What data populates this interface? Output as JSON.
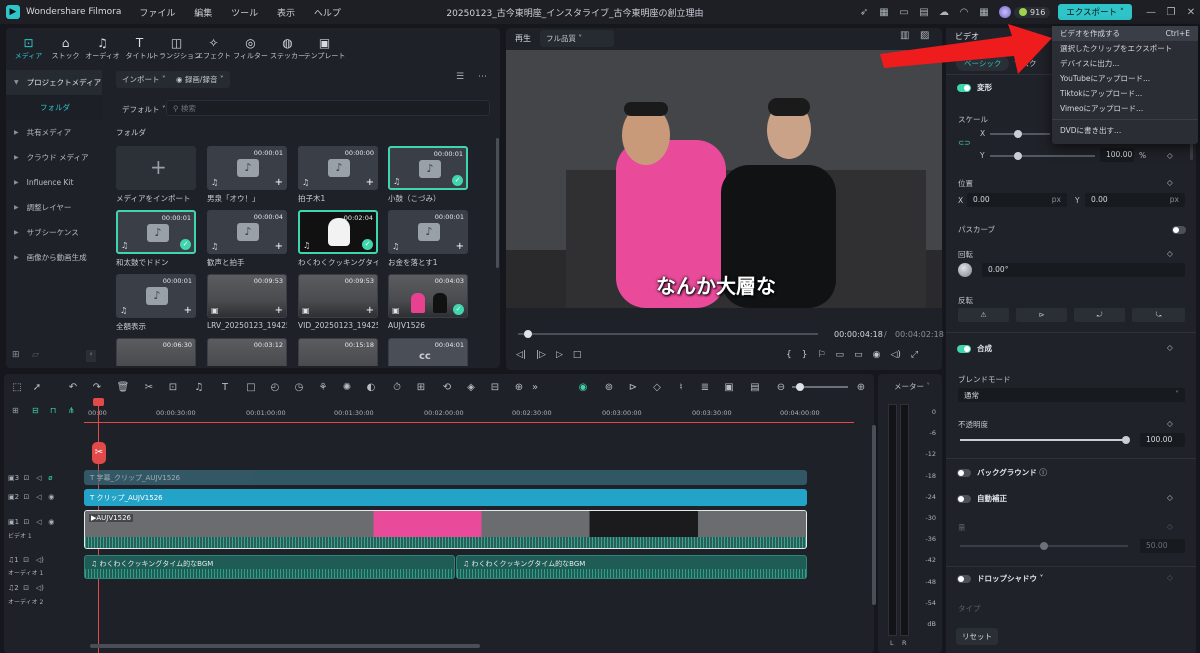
{
  "app": {
    "name": "Wondershare Filmora",
    "window_title": "20250123_古今東明座_インスタライブ_古今東明座の創立理由",
    "menu": [
      "ファイル",
      "編集",
      "ツール",
      "表示",
      "ヘルプ"
    ],
    "credits": "916",
    "export_label": "エクスポート"
  },
  "export_menu": [
    {
      "label": "ビデオを作成する",
      "shortcut": "Ctrl+E"
    },
    {
      "label": "選択したクリップをエクスポート",
      "shortcut": ""
    },
    {
      "label": "デバイスに出力...",
      "shortcut": ""
    },
    {
      "label": "YouTubeにアップロード...",
      "shortcut": ""
    },
    {
      "label": "Tiktokにアップロード...",
      "shortcut": ""
    },
    {
      "label": "Vimeoにアップロード...",
      "shortcut": ""
    },
    {
      "label": "DVDに書き出す...",
      "shortcut": ""
    }
  ],
  "media_tabs": [
    "メディア",
    "ストック",
    "オーディオ",
    "タイトル",
    "トランジション",
    "エフェクト",
    "フィルター",
    "ステッカー",
    "テンプレート"
  ],
  "tree": [
    "プロジェクトメディア",
    "フォルダ",
    "共有メディア",
    "クラウド メディア",
    "Influence Kit",
    "調整レイヤー",
    "サブシーケンス",
    "画像から動画生成"
  ],
  "media_toolbar": {
    "import": "インポート",
    "record": "録画/録音",
    "sort": "デフォルト",
    "search_placeholder": "検索",
    "folder": "フォルダ"
  },
  "media_items": [
    {
      "name": "メディアをインポート",
      "dur": "",
      "kind": "import"
    },
    {
      "name": "男泉「オウ！」",
      "dur": "00:00:01",
      "kind": "audio"
    },
    {
      "name": "拍子木1",
      "dur": "00:00:00",
      "kind": "audio"
    },
    {
      "name": "小鼓（こづみ）",
      "dur": "00:00:01",
      "kind": "audio",
      "used": true
    },
    {
      "name": "和太鼓でドドン",
      "dur": "00:00:01",
      "kind": "audio",
      "used": true
    },
    {
      "name": "歓声と拍手",
      "dur": "00:00:04",
      "kind": "audio"
    },
    {
      "name": "わくわくクッキングタイム的...",
      "dur": "00:02:04",
      "kind": "music",
      "used": true
    },
    {
      "name": "お金を落とす1",
      "dur": "00:00:01",
      "kind": "audio"
    },
    {
      "name": "全額表示",
      "dur": "00:00:01",
      "kind": "audio"
    },
    {
      "name": "LRV_20250123_19425...",
      "dur": "00:09:53",
      "kind": "video"
    },
    {
      "name": "VID_20250123_19425...",
      "dur": "00:09:53",
      "kind": "video"
    },
    {
      "name": "AUJV1526",
      "dur": "00:04:03",
      "kind": "video",
      "used": true
    },
    {
      "name": "",
      "dur": "00:06:30",
      "kind": "video"
    },
    {
      "name": "",
      "dur": "00:03:12",
      "kind": "video"
    },
    {
      "name": "",
      "dur": "00:15:18",
      "kind": "video"
    },
    {
      "name": "",
      "dur": "00:04:01",
      "kind": "cc"
    }
  ],
  "player": {
    "tab": "再生",
    "quality": "フル品質",
    "subtitle": "なんか大層な",
    "current": "00:00:04:18",
    "sep": "/",
    "total": "00:04:02:18"
  },
  "timeline": {
    "ruler": [
      "00:00",
      "00:00:30:00",
      "00:01:00:00",
      "00:01:30:00",
      "00:02:00:00",
      "00:02:30:00",
      "00:03:00:00",
      "00:03:30:00",
      "00:04:00:00"
    ],
    "tracks": {
      "t3": "3",
      "t2": "2",
      "t1": "1",
      "a1": "1",
      "a2": "2",
      "video1": "ビデオ 1",
      "audio1": "オーディオ 1",
      "audio2": "オーディオ 2"
    },
    "clip_t3": "字幕_クリップ_AUJV1526",
    "clip_t2": "クリップ_AUJV1526",
    "clip_video": "AUJV1526",
    "clip_a1": "わくわくクッキングタイム的なBGM",
    "clip_a1b": "わくわくクッキングタイム的なBGM"
  },
  "meter": {
    "title": "メーター",
    "scale": [
      "0",
      "-6",
      "-12",
      "-18",
      "-24",
      "-30",
      "-36",
      "-42",
      "-48",
      "-54",
      "dB"
    ],
    "l": "L",
    "r": "R"
  },
  "props": {
    "tab_video": "ビデオ",
    "sub_basic": "ベーシック",
    "sub_mask": "マスク",
    "transform": "変形",
    "scale": "スケール",
    "x": "X",
    "y": "Y",
    "scale_y": "100.00",
    "pct": "%",
    "position": "位置",
    "pos_x": "0.00",
    "pos_y": "0.00",
    "px": "px",
    "path": "パスカーブ",
    "rotate": "回転",
    "rotate_val": "0.00°",
    "flip": "反転",
    "composite": "合成",
    "blend": "ブレンドモード",
    "blend_val": "通常",
    "opacity": "不透明度",
    "opacity_val": "100.00",
    "background": "バックグラウンド",
    "auto": "自動補正",
    "auto_val": "50.00",
    "auto_lbl": "量",
    "shadow": "ドロップシャドウ",
    "shadow_type": "タイプ",
    "reset": "リセット"
  }
}
